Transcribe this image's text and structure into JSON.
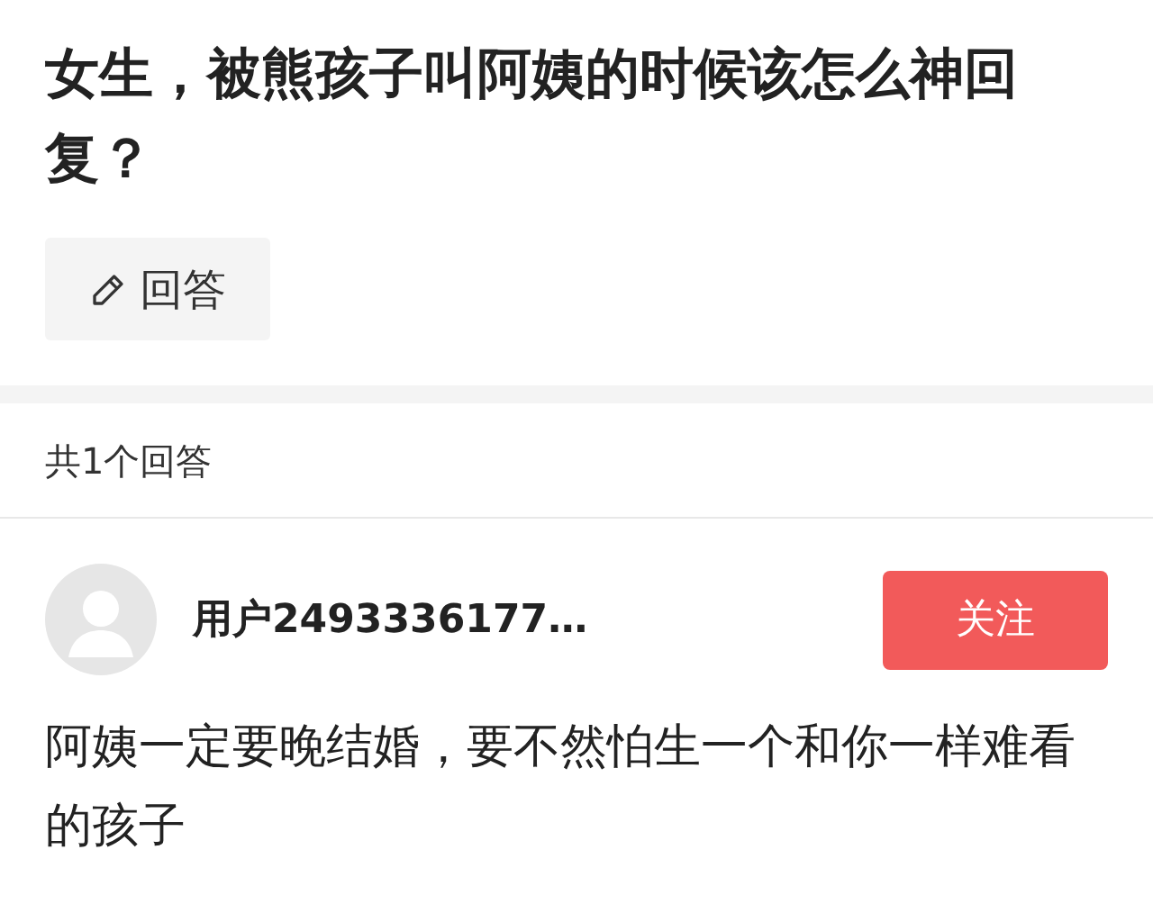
{
  "question": {
    "title": "女生，被熊孩子叫阿姨的时候该怎么神回复？",
    "answer_button": "回答"
  },
  "answer_count": "共1个回答",
  "answers": [
    {
      "user": {
        "name": "用户2493336177…",
        "following": false,
        "follow_label": "关注"
      },
      "text": "阿姨一定要晚结婚，要不然怕生一个和你一样难看的孩子"
    }
  ]
}
